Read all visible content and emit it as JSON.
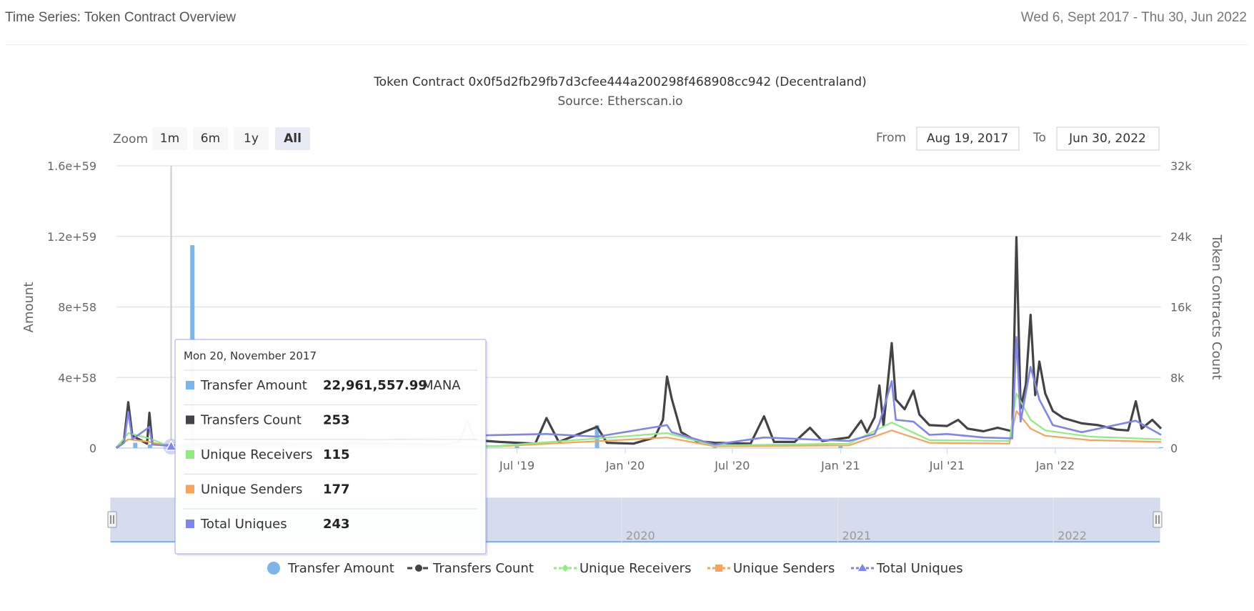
{
  "header": {
    "title": "Time Series: Token Contract Overview",
    "date_range": "Wed 6, Sept 2017 - Thu 30, Jun 2022"
  },
  "chart_data": {
    "type": "line",
    "title": "Token Contract 0x0f5d2fb29fb7d3cfee444a200298f468908cc942 (Decentraland)",
    "subtitle": "Source: Etherscan.io",
    "zoom": {
      "label": "Zoom",
      "options": [
        "1m",
        "6m",
        "1y",
        "All"
      ],
      "selected": "All"
    },
    "range_selector": {
      "from_label": "From",
      "from_value": "Aug 19, 2017",
      "to_label": "To",
      "to_value": "Jun 30, 2022"
    },
    "y_left": {
      "label": "Amount",
      "ticks": [
        "0",
        "4e+58",
        "8e+58",
        "1.2e+59",
        "1.6e+59"
      ],
      "range": [
        0,
        1.6e+59
      ]
    },
    "y_right": {
      "label": "Token Contracts Count",
      "ticks": [
        "0",
        "8k",
        "16k",
        "24k",
        "32k"
      ],
      "range": [
        0,
        32000
      ]
    },
    "x_ticks": [
      "Jul '19",
      "Jan '20",
      "Jul '20",
      "Jan '21",
      "Jul '21",
      "Jan '22"
    ],
    "x_range": [
      "2017-08-19",
      "2022-06-30"
    ],
    "navigator": {
      "labels": [
        "2020",
        "2021",
        "2022"
      ]
    },
    "series": [
      {
        "name": "Transfer Amount",
        "color": "#7cb5ec",
        "marker": "circle",
        "points": [
          [
            "2017-09-20",
            3e+57
          ],
          [
            "2017-10-15",
            2e+57
          ],
          [
            "2017-12-26",
            1.15e+59
          ],
          [
            "2018-01-20",
            1e+57
          ],
          [
            "2019-04-05",
            1.5e+57
          ],
          [
            "2019-07-01",
            1e+57
          ],
          [
            "2019-11-14",
            1.3e+58
          ],
          [
            "2020-06-01",
            5e+56
          ],
          [
            "2021-01-01",
            1e+57
          ],
          [
            "2022-06-30",
            5e+56
          ]
        ]
      },
      {
        "name": "Transfers Count",
        "color": "#434348",
        "marker": "circle",
        "points": [
          [
            "2017-08-19",
            0
          ],
          [
            "2017-09-01",
            1000
          ],
          [
            "2017-09-08",
            5200
          ],
          [
            "2017-09-15",
            1400
          ],
          [
            "2017-10-10",
            500
          ],
          [
            "2017-10-14",
            4000
          ],
          [
            "2017-10-19",
            500
          ],
          [
            "2017-11-20",
            253
          ],
          [
            "2018-03-01",
            600
          ],
          [
            "2018-07-01",
            500
          ],
          [
            "2018-12-01",
            500
          ],
          [
            "2019-03-01",
            400
          ],
          [
            "2019-03-25",
            700
          ],
          [
            "2019-04-08",
            3100
          ],
          [
            "2019-04-20",
            900
          ],
          [
            "2019-06-01",
            700
          ],
          [
            "2019-08-01",
            500
          ],
          [
            "2019-08-20",
            3400
          ],
          [
            "2019-09-10",
            700
          ],
          [
            "2019-11-14",
            2400
          ],
          [
            "2019-12-01",
            600
          ],
          [
            "2020-01-15",
            500
          ],
          [
            "2020-02-20",
            1200
          ],
          [
            "2020-03-05",
            3200
          ],
          [
            "2020-03-12",
            8100
          ],
          [
            "2020-03-20",
            5600
          ],
          [
            "2020-04-05",
            1800
          ],
          [
            "2020-05-01",
            800
          ],
          [
            "2020-06-01",
            600
          ],
          [
            "2020-08-01",
            500
          ],
          [
            "2020-08-24",
            3600
          ],
          [
            "2020-09-10",
            700
          ],
          [
            "2020-10-15",
            700
          ],
          [
            "2020-11-10",
            2300
          ],
          [
            "2020-12-01",
            800
          ],
          [
            "2021-01-15",
            1200
          ],
          [
            "2021-02-05",
            3100
          ],
          [
            "2021-02-15",
            1800
          ],
          [
            "2021-02-28",
            3500
          ],
          [
            "2021-03-08",
            7100
          ],
          [
            "2021-03-15",
            2500
          ],
          [
            "2021-03-29",
            11900
          ],
          [
            "2021-04-05",
            5500
          ],
          [
            "2021-04-20",
            4400
          ],
          [
            "2021-05-05",
            6500
          ],
          [
            "2021-05-15",
            3800
          ],
          [
            "2021-06-01",
            2600
          ],
          [
            "2021-07-01",
            2500
          ],
          [
            "2021-07-20",
            3200
          ],
          [
            "2021-08-05",
            2200
          ],
          [
            "2021-09-01",
            1900
          ],
          [
            "2021-09-25",
            2300
          ],
          [
            "2021-10-20",
            1900
          ],
          [
            "2021-10-27",
            23900
          ],
          [
            "2021-11-03",
            4500
          ],
          [
            "2021-11-12",
            7200
          ],
          [
            "2021-11-20",
            15100
          ],
          [
            "2021-11-28",
            6000
          ],
          [
            "2021-12-05",
            9800
          ],
          [
            "2021-12-15",
            6200
          ],
          [
            "2021-12-28",
            4200
          ],
          [
            "2022-01-15",
            3400
          ],
          [
            "2022-02-15",
            2800
          ],
          [
            "2022-03-15",
            2600
          ],
          [
            "2022-04-15",
            2100
          ],
          [
            "2022-05-05",
            2000
          ],
          [
            "2022-05-18",
            5300
          ],
          [
            "2022-05-28",
            2200
          ],
          [
            "2022-06-15",
            3200
          ],
          [
            "2022-06-30",
            2200
          ]
        ]
      },
      {
        "name": "Unique Receivers",
        "color": "#90ed7d",
        "marker": "diamond",
        "points": [
          [
            "2017-08-19",
            0
          ],
          [
            "2017-09-08",
            1700
          ],
          [
            "2017-10-14",
            1100
          ],
          [
            "2017-11-20",
            115
          ],
          [
            "2018-06-01",
            200
          ],
          [
            "2019-06-01",
            250
          ],
          [
            "2020-03-12",
            1700
          ],
          [
            "2020-06-01",
            300
          ],
          [
            "2021-01-15",
            500
          ],
          [
            "2021-03-29",
            2900
          ],
          [
            "2021-06-01",
            900
          ],
          [
            "2021-10-15",
            800
          ],
          [
            "2021-10-27",
            6200
          ],
          [
            "2021-11-20",
            3200
          ],
          [
            "2021-12-15",
            2000
          ],
          [
            "2022-03-01",
            1300
          ],
          [
            "2022-06-30",
            1000
          ]
        ]
      },
      {
        "name": "Unique Senders",
        "color": "#f7a35c",
        "marker": "square",
        "points": [
          [
            "2017-08-19",
            0
          ],
          [
            "2017-09-08",
            1000
          ],
          [
            "2017-10-14",
            700
          ],
          [
            "2017-11-20",
            177
          ],
          [
            "2018-06-01",
            150
          ],
          [
            "2019-06-01",
            200
          ],
          [
            "2020-03-12",
            1200
          ],
          [
            "2020-06-01",
            200
          ],
          [
            "2021-01-15",
            300
          ],
          [
            "2021-03-29",
            2000
          ],
          [
            "2021-06-01",
            600
          ],
          [
            "2021-10-15",
            500
          ],
          [
            "2021-10-27",
            4200
          ],
          [
            "2021-11-20",
            2200
          ],
          [
            "2021-12-15",
            1400
          ],
          [
            "2022-03-01",
            900
          ],
          [
            "2022-06-30",
            700
          ]
        ]
      },
      {
        "name": "Total Uniques",
        "color": "#8085e9",
        "marker": "triangle",
        "points": [
          [
            "2017-08-19",
            0
          ],
          [
            "2017-09-01",
            600
          ],
          [
            "2017-09-08",
            4100
          ],
          [
            "2017-09-15",
            1000
          ],
          [
            "2017-10-14",
            2400
          ],
          [
            "2017-10-19",
            400
          ],
          [
            "2017-11-20",
            243
          ],
          [
            "2018-06-01",
            300
          ],
          [
            "2019-04-08",
            1400
          ],
          [
            "2019-08-20",
            1600
          ],
          [
            "2019-11-14",
            1300
          ],
          [
            "2020-03-12",
            2600
          ],
          [
            "2020-03-20",
            1800
          ],
          [
            "2020-06-01",
            400
          ],
          [
            "2020-08-24",
            1200
          ],
          [
            "2021-01-15",
            800
          ],
          [
            "2021-02-28",
            1600
          ],
          [
            "2021-03-08",
            2800
          ],
          [
            "2021-03-29",
            7600
          ],
          [
            "2021-04-05",
            3200
          ],
          [
            "2021-05-05",
            3000
          ],
          [
            "2021-06-01",
            1500
          ],
          [
            "2021-07-01",
            1600
          ],
          [
            "2021-09-01",
            1200
          ],
          [
            "2021-10-20",
            1100
          ],
          [
            "2021-10-27",
            12600
          ],
          [
            "2021-11-03",
            3000
          ],
          [
            "2021-11-20",
            9200
          ],
          [
            "2021-12-05",
            5500
          ],
          [
            "2021-12-28",
            2600
          ],
          [
            "2022-02-15",
            1800
          ],
          [
            "2022-05-18",
            3100
          ],
          [
            "2022-06-30",
            1500
          ]
        ]
      }
    ],
    "tooltip": {
      "date": "Mon 20, November 2017",
      "rows": [
        {
          "name": "Transfer Amount",
          "value": "22,961,557.99",
          "unit": "MANA",
          "color": "#7cb5ec"
        },
        {
          "name": "Transfers Count",
          "value": "253",
          "unit": "",
          "color": "#434348"
        },
        {
          "name": "Unique Receivers",
          "value": "115",
          "unit": "",
          "color": "#90ed7d"
        },
        {
          "name": "Unique Senders",
          "value": "177",
          "unit": "",
          "color": "#f7a35c"
        },
        {
          "name": "Total Uniques",
          "value": "243",
          "unit": "",
          "color": "#8085e9"
        }
      ]
    },
    "hover_date": "2017-11-20",
    "legend": {
      "position": "bottom"
    }
  }
}
